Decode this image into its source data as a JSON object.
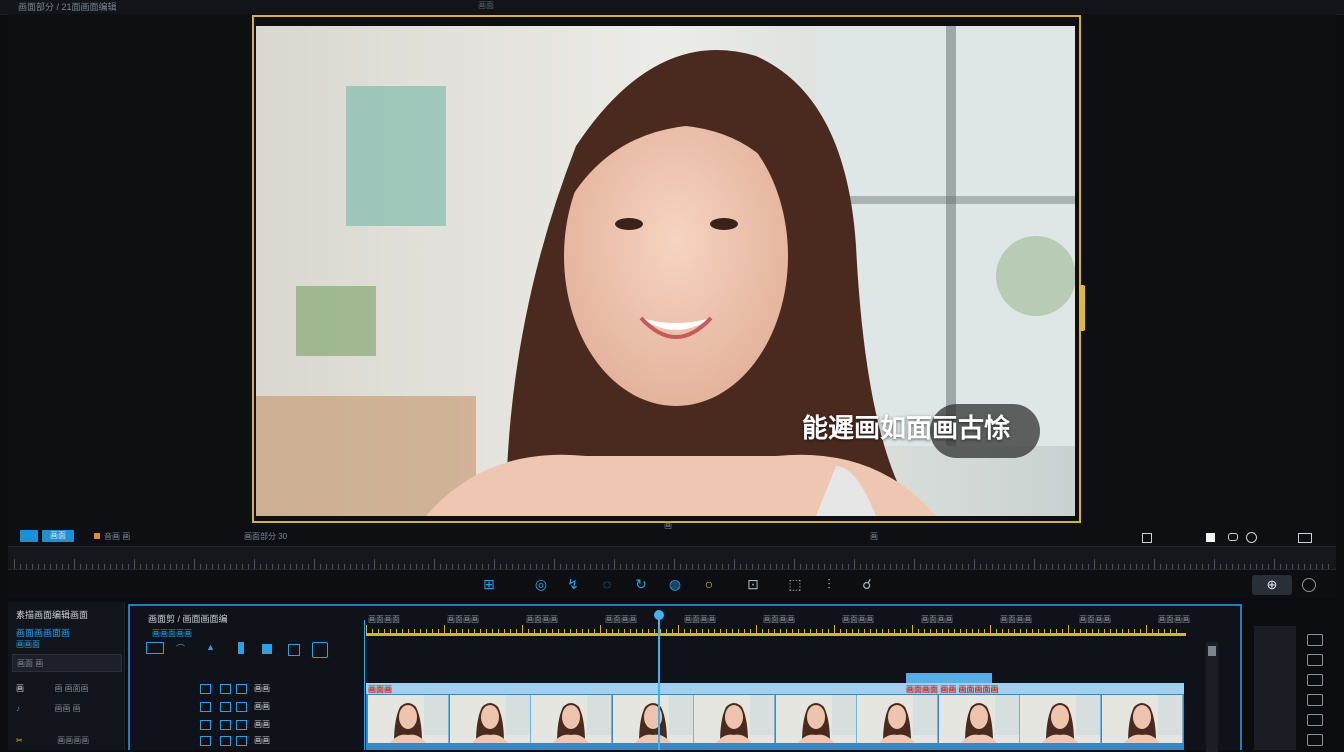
{
  "header": {
    "title": "画面部分 / 21面画面编辑",
    "secondary": "画面"
  },
  "viewer": {
    "caption": "能遲画如面画古悇",
    "colors": {
      "frame": "#d8b13a",
      "accent": "#1d8fd4"
    }
  },
  "controls": {
    "chip_a": "",
    "chip_b": "画面",
    "status": "音画 画",
    "timecode": "画面部分 30",
    "mid_marker": "画",
    "right_label": "画",
    "icons": [
      "fit-icon",
      "square-icon",
      "link-icon",
      "settings-icon",
      "more-icon"
    ]
  },
  "toolbar": {
    "tools": [
      {
        "glyph": "⊞",
        "name": "split-tool-icon"
      },
      {
        "glyph": "◎",
        "name": "ripple-tool-icon"
      },
      {
        "glyph": "↯",
        "name": "razor-tool-icon"
      },
      {
        "glyph": "◌",
        "name": "rotate-tool-icon"
      },
      {
        "glyph": "↻",
        "name": "redo-tool-icon"
      },
      {
        "glyph": "◍",
        "name": "speed-tool-icon"
      },
      {
        "glyph": "○",
        "name": "color-tool-icon"
      },
      {
        "glyph": "⊡",
        "name": "crop-tool-icon"
      },
      {
        "glyph": "⬚",
        "name": "mask-tool-icon"
      },
      {
        "glyph": "⫶",
        "name": "audio-tool-icon"
      },
      {
        "glyph": "☌",
        "name": "effects-tool-icon"
      }
    ],
    "right_btn": "⊕"
  },
  "left_panel": {
    "title": "素描画面编辑画面",
    "subtitle": "画面画画面画",
    "tag": "画画面",
    "search": "画面 画",
    "items": [
      {
        "icon": "画",
        "label": "画 画面画"
      },
      {
        "icon": "♪",
        "label": "画画 画"
      },
      {
        "icon": "✂",
        "label": "画画画画"
      }
    ]
  },
  "timeline": {
    "title": "画面剪 / 画面画面编",
    "subtitle": "画画面画画",
    "ruler_labels": [
      "画面画面",
      "画面画画",
      "画面画画",
      "画面画画",
      "画面画画",
      "画面画画",
      "画面画画",
      "画面画画",
      "画面画画",
      "画面画画",
      "画面画画"
    ],
    "track_label_left": "画面画",
    "track_label_right": "画面画面 画画 画面画面画",
    "columns": [
      "画画",
      "画画",
      "画画"
    ]
  }
}
